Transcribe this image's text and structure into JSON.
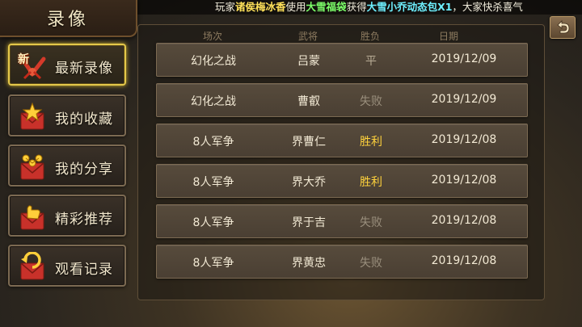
{
  "header": {
    "title": "录像"
  },
  "marquee": {
    "parts": [
      {
        "text": "玩家",
        "style": "w"
      },
      {
        "text": "诸侯梅冰香",
        "style": "y"
      },
      {
        "text": "使用",
        "style": "w"
      },
      {
        "text": "大雪福袋",
        "style": "g"
      },
      {
        "text": "获得",
        "style": "w"
      },
      {
        "text": "大雪小乔动态包X1",
        "style": "c"
      },
      {
        "text": "，大家快杀喜气",
        "style": "w"
      }
    ]
  },
  "sidebar": {
    "items": [
      {
        "label": "最新录像",
        "icon": "new-badge-icon",
        "active": true
      },
      {
        "label": "我的收藏",
        "icon": "star-envelope-icon",
        "active": false
      },
      {
        "label": "我的分享",
        "icon": "share-envelope-icon",
        "active": false
      },
      {
        "label": "精彩推荐",
        "icon": "thumbs-up-envelope-icon",
        "active": false
      },
      {
        "label": "观看记录",
        "icon": "history-envelope-icon",
        "active": false
      }
    ],
    "new_badge": "新"
  },
  "table": {
    "headers": [
      "场次",
      "武将",
      "胜负",
      "日期"
    ],
    "rows": [
      {
        "mode": "幻化之战",
        "general": "吕蒙",
        "result": "平",
        "date": "2019/12/09",
        "result_type": "tie"
      },
      {
        "mode": "幻化之战",
        "general": "曹叡",
        "result": "失败",
        "date": "2019/12/09",
        "result_type": "lose"
      },
      {
        "mode": "8人军争",
        "general": "界曹仁",
        "result": "胜利",
        "date": "2019/12/08",
        "result_type": "win"
      },
      {
        "mode": "8人军争",
        "general": "界大乔",
        "result": "胜利",
        "date": "2019/12/08",
        "result_type": "win"
      },
      {
        "mode": "8人军争",
        "general": "界于吉",
        "result": "失败",
        "date": "2019/12/08",
        "result_type": "lose"
      },
      {
        "mode": "8人军争",
        "general": "界黄忠",
        "result": "失败",
        "date": "2019/12/08",
        "result_type": "lose"
      }
    ]
  },
  "colors": {
    "win": "#ffd23c",
    "lose": "#9a8f7d",
    "tie": "#b9ad96",
    "accent": "#e4c84a"
  }
}
